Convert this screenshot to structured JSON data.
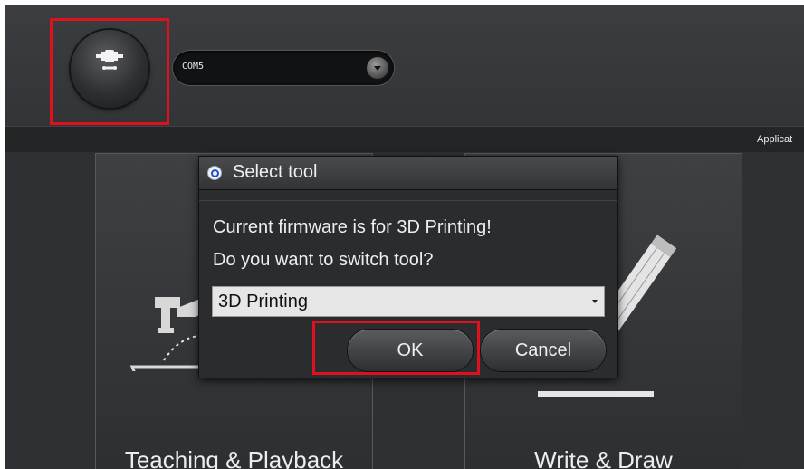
{
  "header": {
    "connect_button_icon": "plug-connect-icon",
    "port_select": {
      "value": "COM5"
    }
  },
  "menubar": {
    "app_menu_label": "Applicat"
  },
  "cards": [
    {
      "label": "Teaching & Playback",
      "icon": "robot-arm-icon"
    },
    {
      "label": "Write & Draw",
      "icon": "pencil-icon"
    }
  ],
  "dialog": {
    "title": "Select tool",
    "message_line1": "Current firmware is for 3D Printing!",
    "message_line2": "Do you want to switch tool?",
    "tool_select": {
      "value": "3D Printing"
    },
    "ok_label": "OK",
    "cancel_label": "Cancel"
  },
  "colors": {
    "highlight": "#e0101e",
    "background": "#2e3033",
    "dialog_bg": "#2b2c2e"
  }
}
